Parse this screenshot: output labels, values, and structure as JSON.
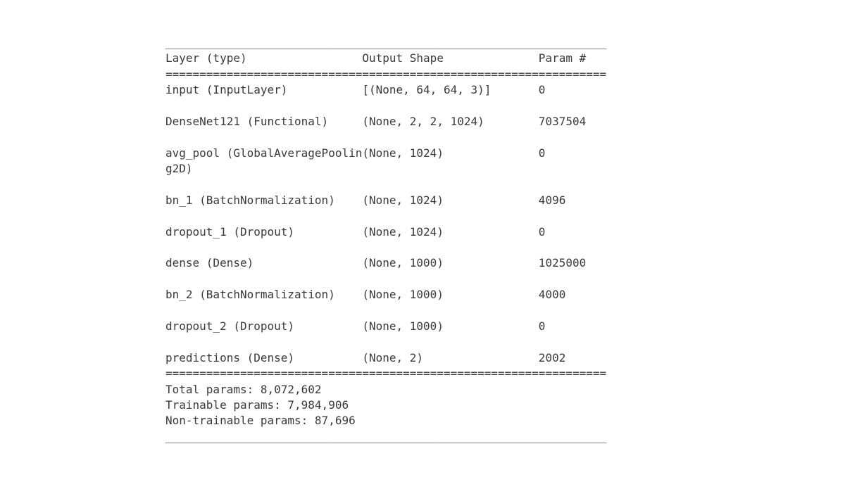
{
  "model_summary": {
    "columns": {
      "layer": "Layer (type)",
      "output_shape": "Output Shape",
      "params": "Param #"
    },
    "col_widths": {
      "layer": 29,
      "output_shape": 26,
      "params": 10
    },
    "separator_char": "=",
    "underscore_char": "_",
    "separator_width": 65,
    "layers": [
      {
        "name": "input (InputLayer)",
        "shape": "[(None, 64, 64, 3)]",
        "params": "0"
      },
      {
        "name": "DenseNet121 (Functional)",
        "shape": "(None, 2, 2, 1024)",
        "params": "7037504"
      },
      {
        "name": "avg_pool (GlobalAveragePooling2D)",
        "shape": "(None, 1024)",
        "params": "0"
      },
      {
        "name": "bn_1 (BatchNormalization)",
        "shape": "(None, 1024)",
        "params": "4096"
      },
      {
        "name": "dropout_1 (Dropout)",
        "shape": "(None, 1024)",
        "params": "0"
      },
      {
        "name": "dense (Dense)",
        "shape": "(None, 1000)",
        "params": "1025000"
      },
      {
        "name": "bn_2 (BatchNormalization)",
        "shape": "(None, 1000)",
        "params": "4000"
      },
      {
        "name": "dropout_2 (Dropout)",
        "shape": "(None, 1000)",
        "params": "0"
      },
      {
        "name": "predictions (Dense)",
        "shape": "(None, 2)",
        "params": "2002"
      }
    ],
    "totals": {
      "total_params": "Total params: 8,072,602",
      "trainable_params": "Trainable params: 7,984,906",
      "non_trainable_params": "Non-trainable params: 87,696"
    }
  }
}
